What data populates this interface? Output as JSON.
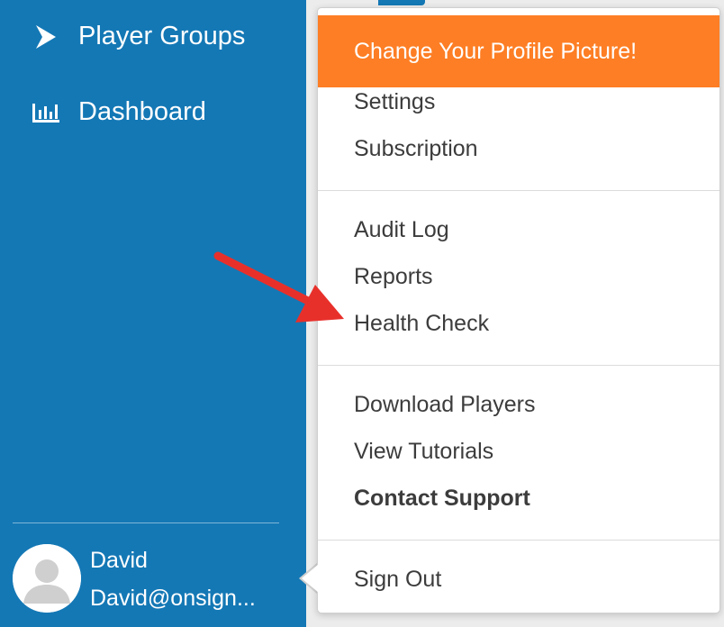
{
  "sidebar": {
    "items": [
      {
        "label": "Player Groups",
        "icon": "play-icon"
      },
      {
        "label": "Dashboard",
        "icon": "bar-chart-icon"
      }
    ],
    "user": {
      "name": "David",
      "email": "David@onsign..."
    }
  },
  "dropdown": {
    "highlight_label": "Change Your Profile Picture!",
    "group1": [
      "Settings",
      "Subscription"
    ],
    "group2": [
      "Audit Log",
      "Reports",
      "Health Check"
    ],
    "group3": [
      "Download Players",
      "View Tutorials",
      "Contact Support"
    ],
    "sign_out": "Sign Out"
  },
  "colors": {
    "sidebar_bg": "#1478b5",
    "highlight_bg": "#fd7e24",
    "annotation_arrow": "#e8302b"
  }
}
